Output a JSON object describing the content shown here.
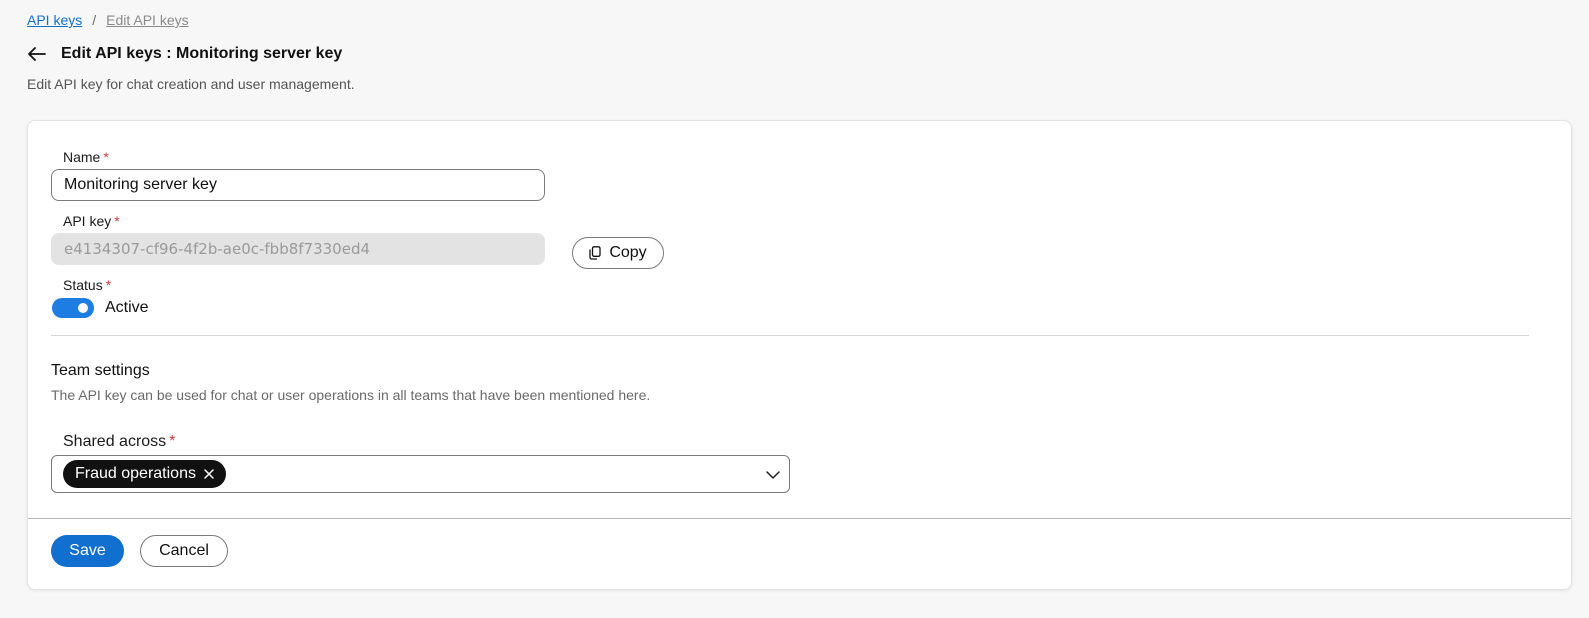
{
  "breadcrumb": {
    "items": [
      {
        "label": "API keys"
      },
      {
        "label": "Edit API keys"
      }
    ],
    "separator": "/"
  },
  "header": {
    "title": "Edit API keys : Monitoring server key",
    "description": "Edit API key for chat creation and user management.",
    "back_icon": "arrow-left-icon"
  },
  "form": {
    "name": {
      "label": "Name",
      "required_mark": "*",
      "value": "Monitoring server key"
    },
    "api_key": {
      "label": "API key",
      "required_mark": "*",
      "value": "e4134307-cf96-4f2b-ae0c-fbb8f7330ed4"
    },
    "copy_button": {
      "label": "Copy",
      "icon": "copy-icon"
    },
    "status": {
      "label": "Status",
      "required_mark": "*",
      "toggle_label": "Active",
      "enabled": true
    }
  },
  "team_settings": {
    "title": "Team settings",
    "description": "The API key can be used for chat or user operations in all teams that have been mentioned here.",
    "shared_across": {
      "label": "Shared across",
      "required_mark": "*",
      "selected": [
        "Fraud operations"
      ]
    }
  },
  "footer": {
    "save_label": "Save",
    "cancel_label": "Cancel"
  },
  "colors": {
    "accent": "#1170cf",
    "toggle_on": "#1d7de3",
    "required": "#d63a3a",
    "chip_bg": "#111111"
  }
}
